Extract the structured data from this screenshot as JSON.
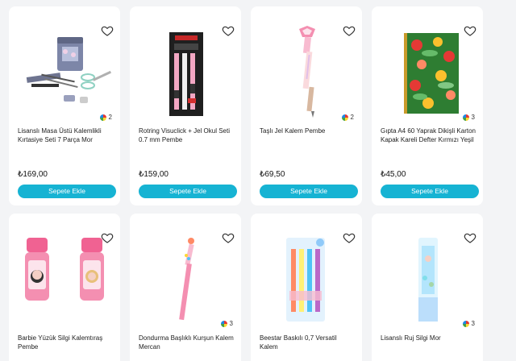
{
  "products": [
    {
      "title": "Lisanslı Masa Üstü Kalemlikli Kırtasiye Seti 7 Parça Mor",
      "price": "₺169,00",
      "variants": "2",
      "button": "Sepete Ekle"
    },
    {
      "title": "Rotring Visuclick + Jel Okul Seti 0.7 mm Pembe",
      "price": "₺159,00",
      "variants": "",
      "button": "Sepete Ekle"
    },
    {
      "title": "Taşlı Jel Kalem Pembe",
      "price": "₺69,50",
      "variants": "2",
      "button": "Sepete Ekle"
    },
    {
      "title": "Gıpta A4 60 Yaprak Dikişli Karton Kapak Kareli Defter Kırmızı Yeşil",
      "price": "₺45,00",
      "variants": "3",
      "button": "Sepete Ekle"
    },
    {
      "title": "Barbie Yüzük Silgi Kalemtıraş Pembe",
      "price": "",
      "variants": "",
      "button": ""
    },
    {
      "title": "Dondurma Başlıklı Kurşun Kalem Mercan",
      "price": "",
      "variants": "3",
      "button": ""
    },
    {
      "title": "Beestar Baskılı 0,7 Versatil Kalem",
      "price": "",
      "variants": "",
      "button": ""
    },
    {
      "title": "Lisanslı Ruj Silgi Mor",
      "price": "",
      "variants": "3",
      "button": ""
    }
  ],
  "colors": {
    "button": "#16b3d3",
    "background": "#f3f4f6",
    "card": "#ffffff"
  },
  "icons": {
    "favorite": "heart-outline-icon",
    "variants": "color-swatch-icon"
  }
}
